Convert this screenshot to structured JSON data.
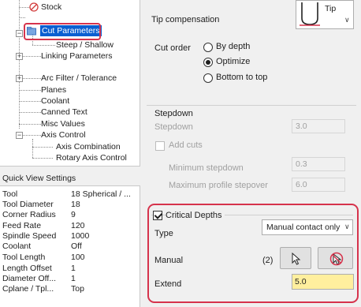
{
  "tree": {
    "items": [
      {
        "label": "Stock",
        "icon": "error-icon"
      },
      {
        "label": "Cut Parameters"
      },
      {
        "label": "Steep / Shallow"
      },
      {
        "label": "Linking Parameters"
      },
      {
        "label": "Arc Filter / Tolerance"
      },
      {
        "label": "Planes"
      },
      {
        "label": "Coolant"
      },
      {
        "label": "Canned Text"
      },
      {
        "label": "Misc Values"
      },
      {
        "label": "Axis Control"
      },
      {
        "label": "Axis Combination"
      },
      {
        "label": "Rotary Axis Control"
      }
    ]
  },
  "quick_view": {
    "title": "Quick View Settings",
    "rows": [
      {
        "key": "Tool",
        "value": "18 Spherical / ..."
      },
      {
        "key": "Tool Diameter",
        "value": "18"
      },
      {
        "key": "Corner Radius",
        "value": "9"
      },
      {
        "key": "Feed Rate",
        "value": "120"
      },
      {
        "key": "Spindle Speed",
        "value": "1000"
      },
      {
        "key": "Coolant",
        "value": "Off"
      },
      {
        "key": "Tool Length",
        "value": "100"
      },
      {
        "key": "Length Offset",
        "value": "1"
      },
      {
        "key": "Diameter Off...",
        "value": "1"
      },
      {
        "key": "Cplane / Tpl...",
        "value": "Top"
      }
    ]
  },
  "tip_compensation": {
    "label": "Tip compensation",
    "value": "Tip"
  },
  "cut_order": {
    "label": "Cut order",
    "options": [
      "By depth",
      "Optimize",
      "Bottom to top"
    ],
    "selected": "Optimize"
  },
  "stepdown": {
    "group_label": "Stepdown",
    "label": "Stepdown",
    "value": "3.0",
    "add_cuts_label": "Add cuts",
    "min_stepdown_label": "Minimum stepdown",
    "min_stepdown_value": "0.3",
    "max_stepover_label": "Maximum profile stepover",
    "max_stepover_value": "6.0"
  },
  "critical_depths": {
    "label": "Critical Depths",
    "type_label": "Type",
    "type_value": "Manual contact only",
    "manual_label": "Manual",
    "manual_count": "(2)",
    "extend_label": "Extend",
    "extend_value": "5.0"
  },
  "colors": {
    "selection_blue": "#0a5fd1",
    "highlight_red": "#d6334c",
    "extend_field_yellow": "#ffef9e"
  }
}
